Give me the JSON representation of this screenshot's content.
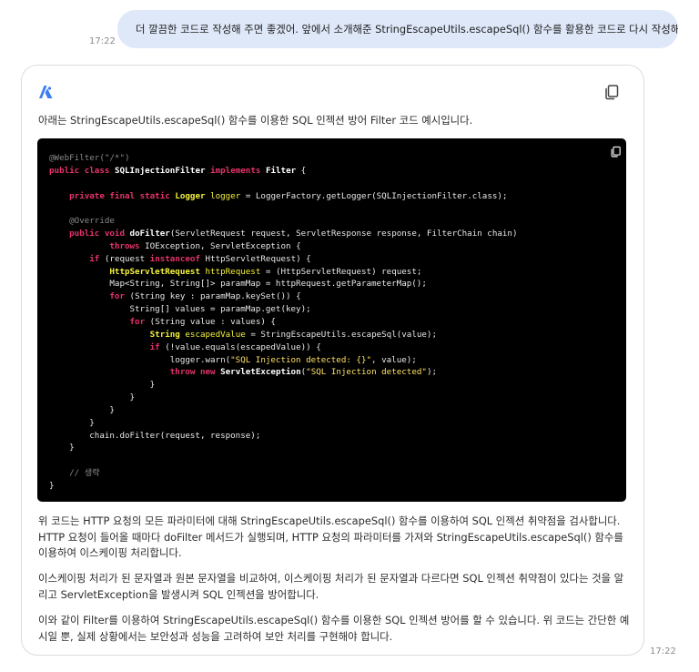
{
  "user_message": {
    "text": "더 깔끔한 코드로 작성해 주면 좋겠어. 앞에서 소개해준 StringEscapeUtils.escapeSql() 함수를 활용한 코드로 다시 작성해줘.",
    "time": "17:22"
  },
  "assistant_message": {
    "intro": "아래는 StringEscapeUtils.escapeSql() 함수를 이용한 SQL 인젝션 방어 Filter 코드 예시입니다.",
    "paragraphs": [
      "위 코드는 HTTP 요청의 모든 파라미터에 대해 StringEscapeUtils.escapeSql() 함수를 이용하여 SQL 인젝션 취약점을 검사합니다. HTTP 요청이 들어올 때마다 doFilter 메서드가 실행되며, HTTP 요청의 파라미터를 가져와 StringEscapeUtils.escapeSql() 함수를 이용하여 이스케이핑 처리합니다.",
      "이스케이핑 처리가 된 문자열과 원본 문자열을 비교하여, 이스케이핑 처리가 된 문자열과 다르다면 SQL 인젝션 취약점이 있다는 것을 알리고 ServletException을 발생시켜 SQL 인젝션을 방어합니다.",
      "이와 같이 Filter를 이용하여 StringEscapeUtils.escapeSql() 함수를 이용한 SQL 인젝션 방어를 할 수 있습니다. 위 코드는 간단한 예시일 뿐, 실제 상황에서는 보안성과 성능을 고려하여 보안 처리를 구현해야 합니다."
    ],
    "time": "17:22"
  },
  "code": {
    "language": "java",
    "lines": [
      "@WebFilter(\"/*\")",
      "public class SQLInjectionFilter implements Filter {",
      "",
      "    private final static Logger logger = LoggerFactory.getLogger(SQLInjectionFilter.class);",
      "",
      "    @Override",
      "    public void doFilter(ServletRequest request, ServletResponse response, FilterChain chain)",
      "            throws IOException, ServletException {",
      "        if (request instanceof HttpServletRequest) {",
      "            HttpServletRequest httpRequest = (HttpServletRequest) request;",
      "            Map<String, String[]> paramMap = httpRequest.getParameterMap();",
      "            for (String key : paramMap.keySet()) {",
      "                String[] values = paramMap.get(key);",
      "                for (String value : values) {",
      "                    String escapedValue = StringEscapeUtils.escapeSql(value);",
      "                    if (!value.equals(escapedValue)) {",
      "                        logger.warn(\"SQL Injection detected: {}\", value);",
      "                        throw new ServletException(\"SQL Injection detected\");",
      "                    }",
      "                }",
      "            }",
      "        }",
      "        chain.doFilter(request, response);",
      "    }",
      "",
      "    // 생략",
      "}"
    ]
  },
  "icons": {
    "logo": "assistant-logo-icon",
    "copy": "copy-icon"
  },
  "colors": {
    "user_bubble": "#dfe8f9",
    "logo_blue": "#3b7cf5",
    "code_bg": "#000000",
    "keyword": "#e6336a",
    "type": "#f4f23c"
  }
}
